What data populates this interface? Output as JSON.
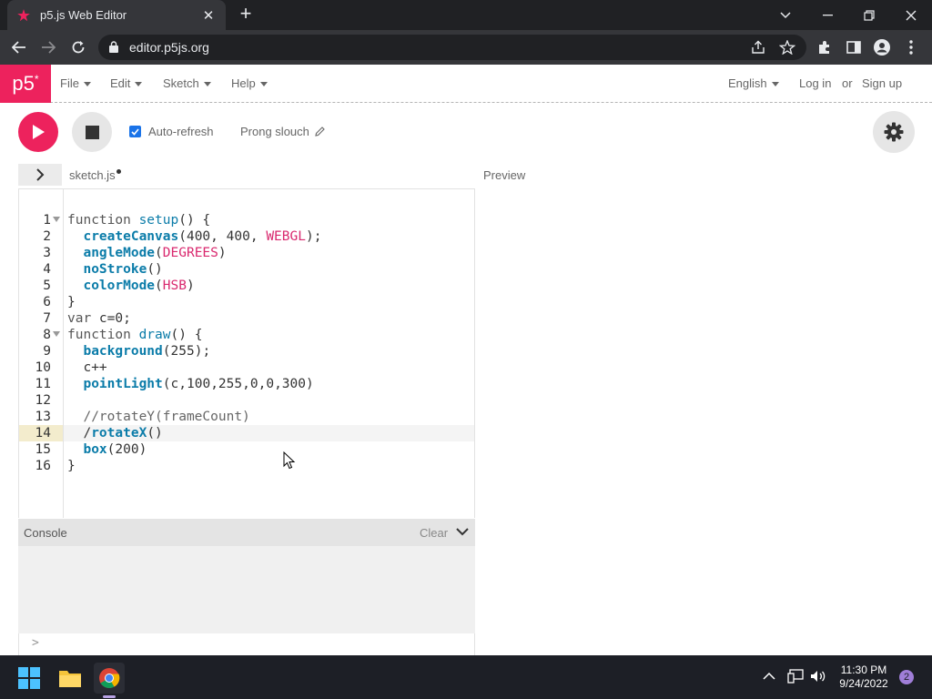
{
  "browser": {
    "tab_title": "p5.js Web Editor",
    "url": "editor.p5js.org"
  },
  "nav": {
    "logo": "p5",
    "logo_sup": "*",
    "menus": [
      "File",
      "Edit",
      "Sketch",
      "Help"
    ],
    "language": "English",
    "login": "Log in",
    "or": "or",
    "signup": "Sign up"
  },
  "toolbar": {
    "auto_refresh_label": "Auto-refresh",
    "auto_refresh_checked": true,
    "sketch_name": "Prong slouch"
  },
  "editor": {
    "file_name": "sketch.js",
    "preview_label": "Preview",
    "active_line": 14,
    "lines": [
      "function setup() {",
      "  createCanvas(400, 400, WEBGL);",
      "  angleMode(DEGREES)",
      "  noStroke()",
      "  colorMode(HSB)",
      "}",
      "var c=0;",
      "function draw() {",
      "  background(255);",
      "  c++",
      "  pointLight(c,100,255,0,0,300)",
      "",
      "  //rotateY(frameCount)",
      "  /rotateX()",
      "  box(200)",
      "}"
    ]
  },
  "console": {
    "label": "Console",
    "clear_label": "Clear",
    "prompt": ">"
  },
  "taskbar": {
    "time": "11:30 PM",
    "date": "9/24/2022",
    "notification_count": "2"
  }
}
